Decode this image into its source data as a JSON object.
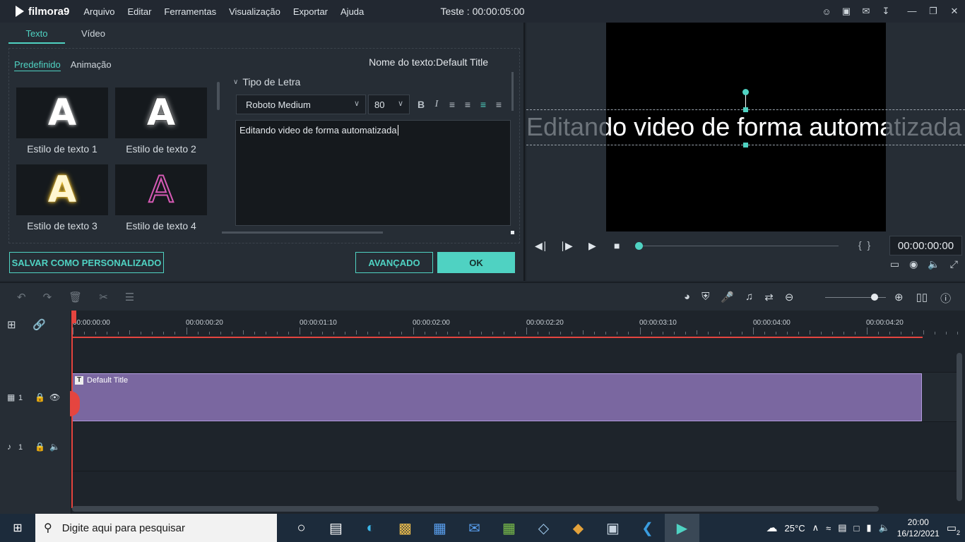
{
  "app": {
    "logo_text": "filmora9",
    "menus": [
      "Arquivo",
      "Editar",
      "Ferramentas",
      "Visualização",
      "Exportar",
      "Ajuda"
    ],
    "title": "Teste : 00:00:05:00"
  },
  "editor": {
    "tabs": [
      "Texto",
      "Vídeo"
    ],
    "subtabs": [
      "Predefinido",
      "Animação"
    ],
    "styles": [
      {
        "label": "Estilo de texto 1",
        "glyph": "A"
      },
      {
        "label": "Estilo de texto 2",
        "glyph": "A"
      },
      {
        "label": "Estilo de texto 3",
        "glyph": "A"
      },
      {
        "label": "Estilo de texto 4",
        "glyph": "A"
      }
    ],
    "name_label": "Nome do texto:Default Title",
    "font_section": "Tipo de Letra",
    "font_family_value": "Roboto Medium",
    "font_size_value": "80",
    "text_value": "Editando video de forma automatizada",
    "buttons": {
      "save_custom": "SALVAR COMO PERSONALIZADO",
      "advanced": "AVANÇADO",
      "ok": "OK"
    }
  },
  "preview": {
    "overlay_text": "Editando video de forma automatizada",
    "timecode": "00:00:00:00",
    "progress": 0
  },
  "timeline": {
    "ruler_labels": [
      "00:00:00:00",
      "00:00:00:20",
      "00:00:01:10",
      "00:00:02:00",
      "00:00:02:20",
      "00:00:03:10",
      "00:00:04:00",
      "00:00:04:20"
    ],
    "video_track_label": "1",
    "audio_track_label": "1",
    "clip_title": "Default Title"
  },
  "taskbar": {
    "search_placeholder": "Digite aqui para pesquisar",
    "temperature": "25°C",
    "time": "20:00",
    "date": "16/12/2021",
    "notification_count": "2"
  },
  "colors": {
    "accent": "#4fd2c2",
    "clip": "#7a67a0",
    "playhead": "#e5453f"
  }
}
